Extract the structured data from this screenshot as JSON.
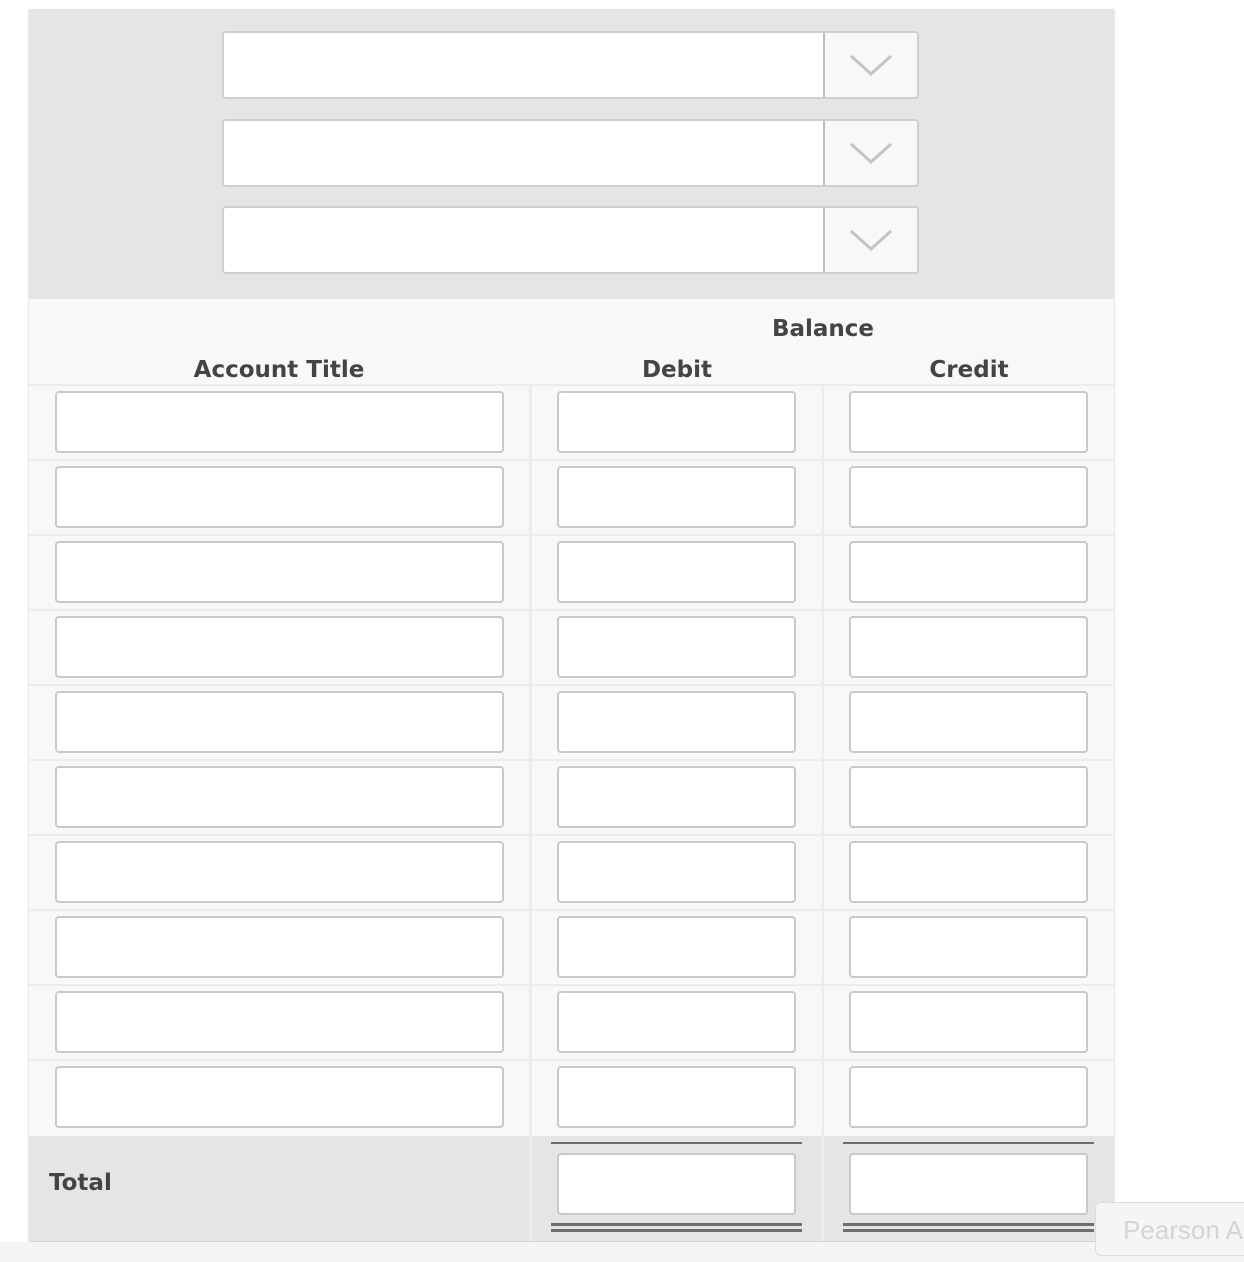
{
  "dropdowns": [
    {
      "selected": ""
    },
    {
      "selected": ""
    },
    {
      "selected": ""
    }
  ],
  "table": {
    "group_header": "Balance",
    "columns": {
      "account_title": "Account Title",
      "debit": "Debit",
      "credit": "Credit"
    },
    "rows": [
      {
        "account": "",
        "debit": "",
        "credit": ""
      },
      {
        "account": "",
        "debit": "",
        "credit": ""
      },
      {
        "account": "",
        "debit": "",
        "credit": ""
      },
      {
        "account": "",
        "debit": "",
        "credit": ""
      },
      {
        "account": "",
        "debit": "",
        "credit": ""
      },
      {
        "account": "",
        "debit": "",
        "credit": ""
      },
      {
        "account": "",
        "debit": "",
        "credit": ""
      },
      {
        "account": "",
        "debit": "",
        "credit": ""
      },
      {
        "account": "",
        "debit": "",
        "credit": ""
      },
      {
        "account": "",
        "debit": "",
        "credit": ""
      }
    ],
    "total": {
      "label": "Total",
      "debit": "",
      "credit": ""
    }
  },
  "badge": {
    "text": "Pearson A"
  },
  "icons": {
    "dropdown_arrow": "chevron-down-icon"
  },
  "colors": {
    "header_bg": "#e5e5e5",
    "table_bg": "#f8f8f8",
    "input_border": "#c9c9c9",
    "text": "#444444",
    "rule": "#6e6e6e"
  }
}
